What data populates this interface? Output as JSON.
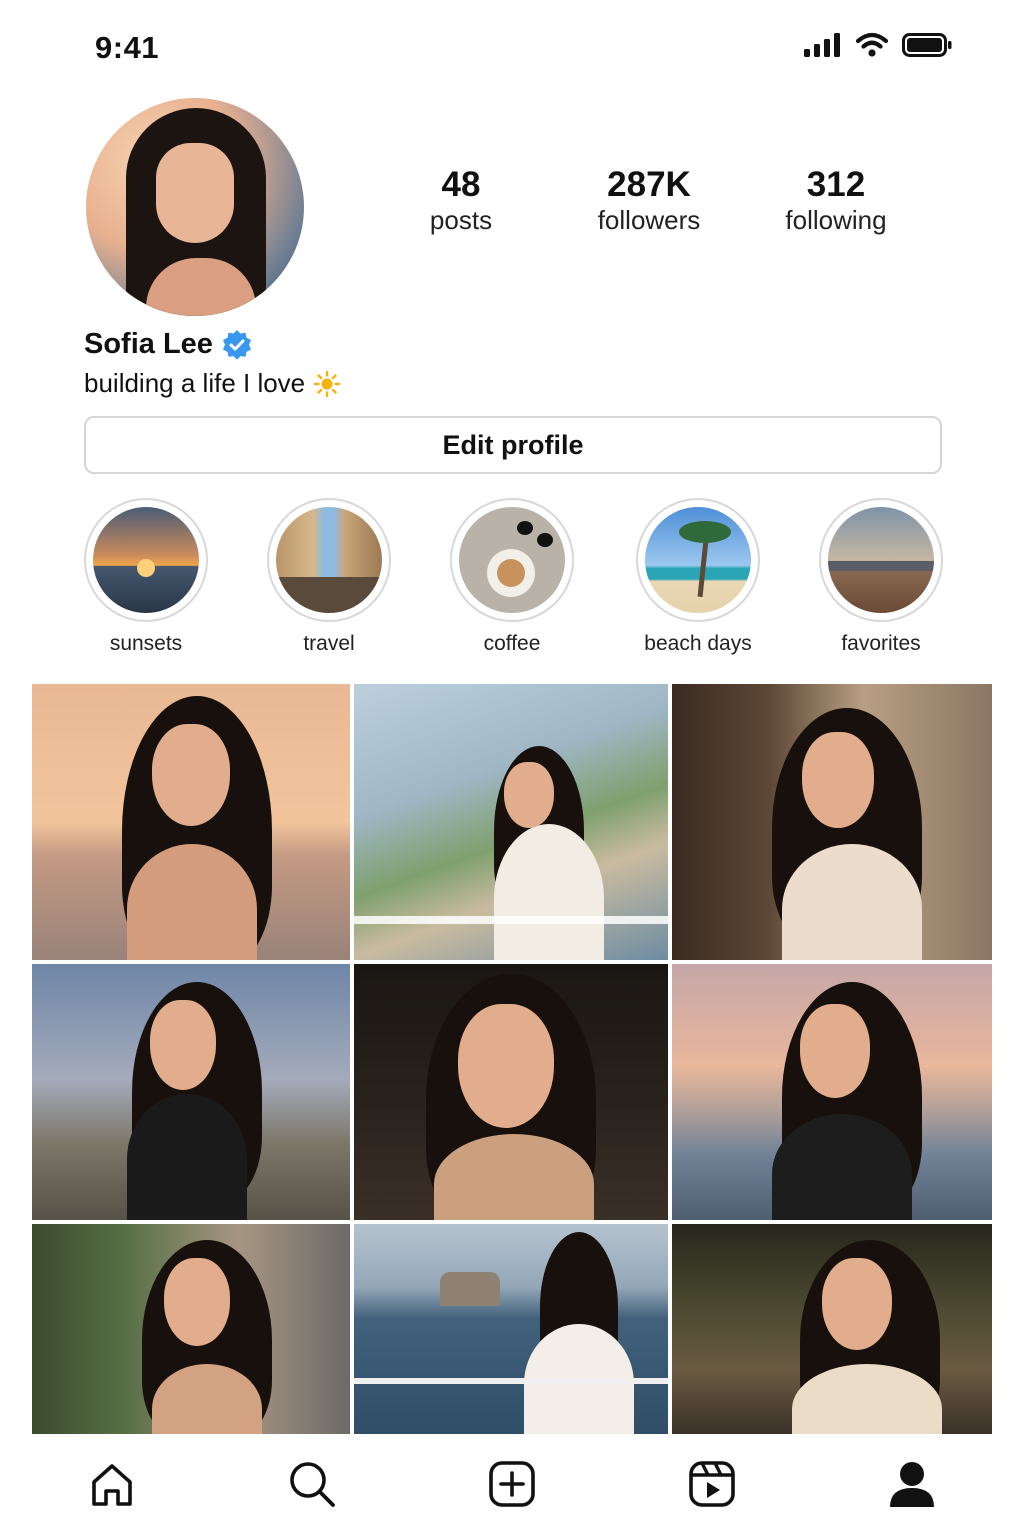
{
  "status_bar": {
    "time": "9:41"
  },
  "profile": {
    "name": "Sofia Lee",
    "bio": "building a life I love",
    "verified": true,
    "stats": [
      {
        "value": "48",
        "label": "posts"
      },
      {
        "value": "287K",
        "label": "followers"
      },
      {
        "value": "312",
        "label": "following"
      }
    ],
    "edit_button": "Edit profile"
  },
  "highlights": [
    {
      "label": "sunsets",
      "icon": "sunset"
    },
    {
      "label": "travel",
      "icon": "street"
    },
    {
      "label": "coffee",
      "icon": "coffee"
    },
    {
      "label": "beach days",
      "icon": "palm-beach"
    },
    {
      "label": "favorites",
      "icon": "city"
    }
  ],
  "posts": [
    {
      "scene": "beach sunset"
    },
    {
      "scene": "cliffside town"
    },
    {
      "scene": "evening street with wine"
    },
    {
      "scene": "lamp-lit bridge"
    },
    {
      "scene": "dark cafe"
    },
    {
      "scene": "harbor sunset"
    },
    {
      "scene": "flowered alley"
    },
    {
      "scene": "sea stacks balcony"
    },
    {
      "scene": "string-light terrace"
    }
  ],
  "bottom_nav": [
    {
      "icon": "home-icon"
    },
    {
      "icon": "search-icon"
    },
    {
      "icon": "create-icon"
    },
    {
      "icon": "reels-icon"
    },
    {
      "icon": "profile-icon",
      "active": true
    }
  ],
  "colors": {
    "verified_badge": "#3897f0",
    "border": "#d5d5d5",
    "sun_emoji": "#f6b20d"
  }
}
